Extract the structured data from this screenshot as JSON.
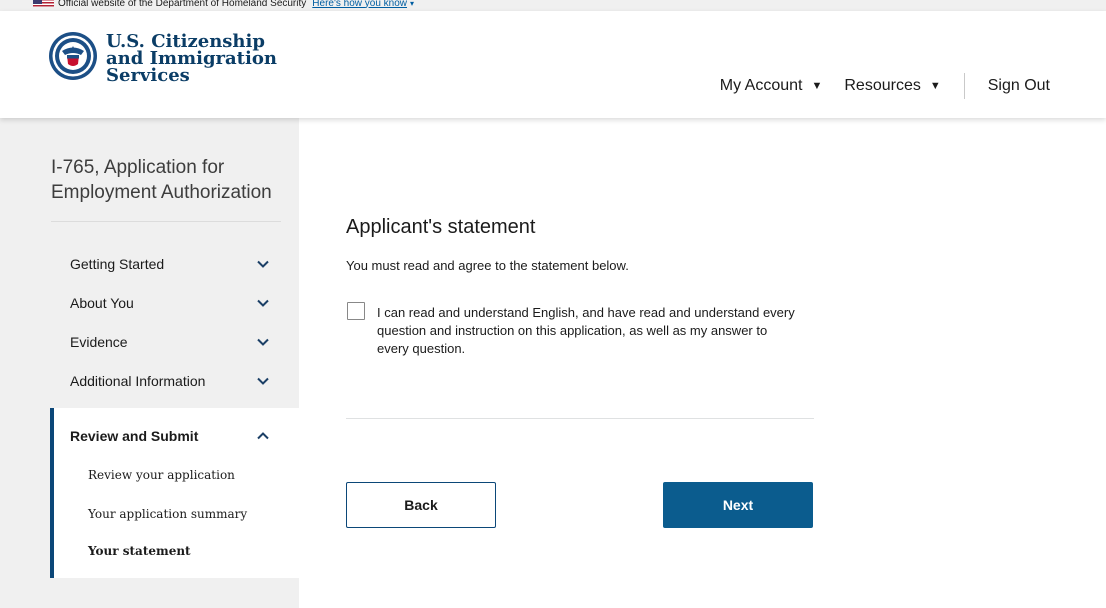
{
  "gov_banner": {
    "text": "Official website of the Department of Homeland Security",
    "link": "Here's how you know"
  },
  "header": {
    "agency_line1": "U.S. Citizenship",
    "agency_line2": "and Immigration",
    "agency_line3": "Services",
    "seal_icon": "dhs-seal-icon",
    "nav": {
      "my_account": "My Account",
      "resources": "Resources",
      "sign_out": "Sign Out"
    }
  },
  "sidebar": {
    "form_title": "I-765, Application for Employment Authorization",
    "sections": [
      {
        "label": "Getting Started",
        "icon": "chevron-down-icon"
      },
      {
        "label": "About You",
        "icon": "chevron-down-icon"
      },
      {
        "label": "Evidence",
        "icon": "chevron-down-icon"
      },
      {
        "label": "Additional Information",
        "icon": "chevron-down-icon"
      }
    ],
    "active_section": {
      "label": "Review and Submit",
      "icon": "chevron-up-icon",
      "items": [
        {
          "label": "Review your application",
          "current": false
        },
        {
          "label": "Your application summary",
          "current": false
        },
        {
          "label": "Your statement",
          "current": true
        }
      ]
    }
  },
  "main": {
    "title": "Applicant's statement",
    "intro": "You must read and agree to the statement below.",
    "statement": "I can read and understand English, and have read and understand every question and instruction on this application, as well as my answer to every question.",
    "checkbox_checked": false,
    "back_label": "Back",
    "next_label": "Next"
  },
  "colors": {
    "brand_navy": "#0b4778",
    "primary_button": "#0b5c8e",
    "sidebar_bg": "#f0f0f0"
  }
}
